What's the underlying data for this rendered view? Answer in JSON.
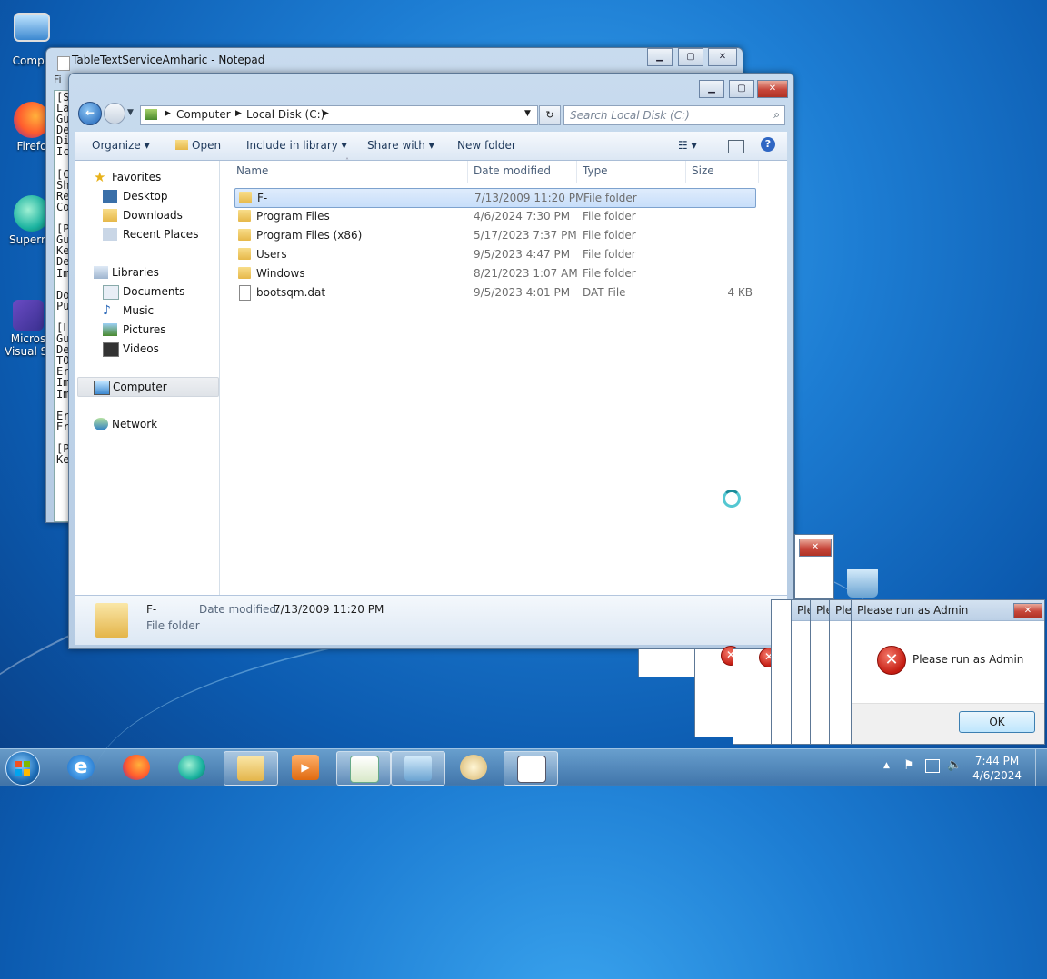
{
  "desktop": {
    "icons": [
      {
        "label": "Compu"
      },
      {
        "label": "Firefo"
      },
      {
        "label": "Supermi"
      },
      {
        "label": "Micros Visual St"
      }
    ]
  },
  "notepad": {
    "title": "TableTextServiceAmharic - Notepad",
    "menu_fragment": "Fi",
    "lines": [
      "[S",
      "La",
      "Gu",
      "De",
      "Di",
      "Ic",
      "",
      "[C",
      "Sh",
      "Re",
      "Co",
      "",
      "[P",
      "Gu",
      "Ke",
      "De",
      "Im",
      "",
      "Do",
      "Pu",
      "",
      "[L",
      "Gu",
      "De",
      "TO",
      "Er",
      "Im",
      "Im",
      "",
      "Er",
      "Er",
      "",
      "[P",
      "Ke"
    ],
    "caption": {
      "minimize": "▁",
      "maximize": "▢",
      "close": "✕"
    }
  },
  "explorer": {
    "breadcrumb": [
      "Computer",
      "Local Disk (C:)"
    ],
    "search_placeholder": "Search Local Disk (C:)",
    "toolbar": {
      "organize": "Organize",
      "open": "Open",
      "include": "Include in library",
      "share": "Share with",
      "new_folder": "New folder"
    },
    "nav": {
      "favorites": "Favorites",
      "desktop": "Desktop",
      "downloads": "Downloads",
      "recent": "Recent Places",
      "libraries": "Libraries",
      "documents": "Documents",
      "music": "Music",
      "pictures": "Pictures",
      "videos": "Videos",
      "computer": "Computer",
      "network": "Network"
    },
    "columns": {
      "name": "Name",
      "date": "Date modified",
      "type": "Type",
      "size": "Size"
    },
    "files": [
      {
        "name": "F-",
        "date": "7/13/2009 11:20 PM",
        "type": "File folder",
        "size": ""
      },
      {
        "name": "Program Files",
        "date": "4/6/2024 7:30 PM",
        "type": "File folder",
        "size": ""
      },
      {
        "name": "Program Files (x86)",
        "date": "5/17/2023 7:37 PM",
        "type": "File folder",
        "size": ""
      },
      {
        "name": "Users",
        "date": "9/5/2023 4:47 PM",
        "type": "File folder",
        "size": ""
      },
      {
        "name": "Windows",
        "date": "8/21/2023 1:07 AM",
        "type": "File folder",
        "size": ""
      },
      {
        "name": "bootsqm.dat",
        "date": "9/5/2023 4:01 PM",
        "type": "DAT File",
        "size": "4 KB"
      }
    ],
    "details": {
      "name": "F-",
      "date_label": "Date modified:",
      "date_value": "7/13/2009 11:20 PM",
      "type": "File folder"
    }
  },
  "dialog": {
    "title": "Please run as Admin",
    "message": "Please run as Admin",
    "ok": "OK",
    "stack_title_fragment": "Ple"
  },
  "taskbar": {
    "time": "7:44 PM",
    "date": "4/6/2024"
  }
}
